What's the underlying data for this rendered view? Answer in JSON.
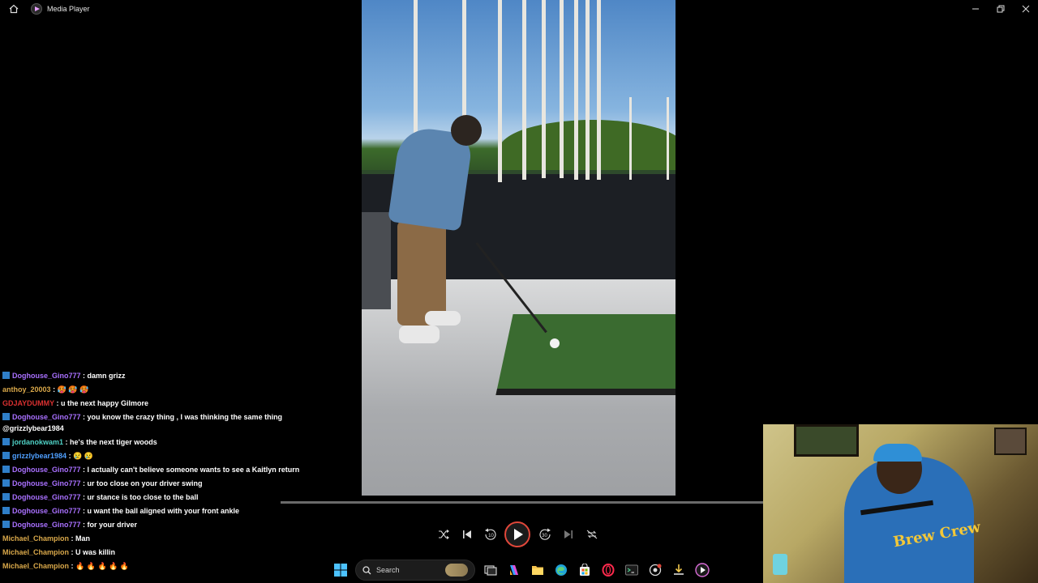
{
  "window": {
    "title": "Media Player"
  },
  "chat": [
    {
      "badge": true,
      "user": "Doghouse_Gino777",
      "color": "purple",
      "text": ": damn grizz"
    },
    {
      "badge": false,
      "user": "anthoy_20003",
      "color": "gold",
      "text": ": 🥵 🥵 🥵"
    },
    {
      "badge": false,
      "user": "GDJAYDUMMY",
      "color": "red",
      "text": ": u the next happy Gilmore"
    },
    {
      "badge": true,
      "user": "Doghouse_Gino777",
      "color": "purple",
      "text": ": you know the crazy thing , I was thinking the same thing @grizzlybear1984"
    },
    {
      "badge": true,
      "user": "jordanokwam1",
      "color": "teal",
      "text": ": he's the next tiger woods"
    },
    {
      "badge": true,
      "user": "grizzlybear1984",
      "color": "blue",
      "text": ": 😢 😢"
    },
    {
      "badge": true,
      "user": "Doghouse_Gino777",
      "color": "purple",
      "text": ": I actually can't believe someone wants to see a Kaitlyn return"
    },
    {
      "badge": true,
      "user": "Doghouse_Gino777",
      "color": "purple",
      "text": ": ur too close on your driver swing"
    },
    {
      "badge": true,
      "user": "Doghouse_Gino777",
      "color": "purple",
      "text": ": ur stance is too close to the ball"
    },
    {
      "badge": true,
      "user": "Doghouse_Gino777",
      "color": "purple",
      "text": ": u want the ball aligned with your front ankle"
    },
    {
      "badge": true,
      "user": "Doghouse_Gino777",
      "color": "purple",
      "text": ": for your driver"
    },
    {
      "badge": false,
      "user": "Michael_Champion",
      "color": "gold",
      "text": ": Man"
    },
    {
      "badge": false,
      "user": "Michael_Champion",
      "color": "gold",
      "text": ": U was killin"
    },
    {
      "badge": false,
      "user": "Michael_Champion",
      "color": "gold",
      "text": ": 🔥 🔥 🔥 🔥 🔥"
    }
  ],
  "controls": {
    "skip_back_seconds": "10",
    "skip_forward_seconds": "30"
  },
  "taskbar": {
    "search_placeholder": "Search"
  },
  "colors": {
    "accent": "#e0473a",
    "username_purple": "#a970ff",
    "username_gold": "#d9a84a",
    "username_red": "#d93030",
    "username_blue": "#4fa0ff",
    "username_teal": "#4fd1c5"
  }
}
